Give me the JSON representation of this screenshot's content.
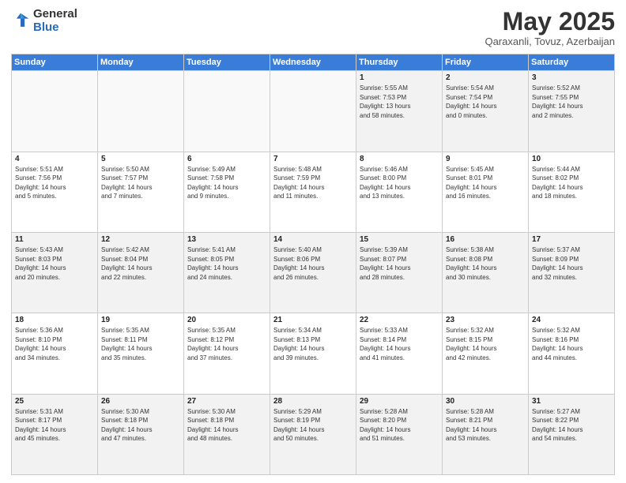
{
  "logo": {
    "general": "General",
    "blue": "Blue"
  },
  "header": {
    "month": "May 2025",
    "location": "Qaraxanli, Tovuz, Azerbaijan"
  },
  "days_of_week": [
    "Sunday",
    "Monday",
    "Tuesday",
    "Wednesday",
    "Thursday",
    "Friday",
    "Saturday"
  ],
  "weeks": [
    [
      {
        "day": "",
        "info": ""
      },
      {
        "day": "",
        "info": ""
      },
      {
        "day": "",
        "info": ""
      },
      {
        "day": "",
        "info": ""
      },
      {
        "day": "1",
        "info": "Sunrise: 5:55 AM\nSunset: 7:53 PM\nDaylight: 13 hours\nand 58 minutes."
      },
      {
        "day": "2",
        "info": "Sunrise: 5:54 AM\nSunset: 7:54 PM\nDaylight: 14 hours\nand 0 minutes."
      },
      {
        "day": "3",
        "info": "Sunrise: 5:52 AM\nSunset: 7:55 PM\nDaylight: 14 hours\nand 2 minutes."
      }
    ],
    [
      {
        "day": "4",
        "info": "Sunrise: 5:51 AM\nSunset: 7:56 PM\nDaylight: 14 hours\nand 5 minutes."
      },
      {
        "day": "5",
        "info": "Sunrise: 5:50 AM\nSunset: 7:57 PM\nDaylight: 14 hours\nand 7 minutes."
      },
      {
        "day": "6",
        "info": "Sunrise: 5:49 AM\nSunset: 7:58 PM\nDaylight: 14 hours\nand 9 minutes."
      },
      {
        "day": "7",
        "info": "Sunrise: 5:48 AM\nSunset: 7:59 PM\nDaylight: 14 hours\nand 11 minutes."
      },
      {
        "day": "8",
        "info": "Sunrise: 5:46 AM\nSunset: 8:00 PM\nDaylight: 14 hours\nand 13 minutes."
      },
      {
        "day": "9",
        "info": "Sunrise: 5:45 AM\nSunset: 8:01 PM\nDaylight: 14 hours\nand 16 minutes."
      },
      {
        "day": "10",
        "info": "Sunrise: 5:44 AM\nSunset: 8:02 PM\nDaylight: 14 hours\nand 18 minutes."
      }
    ],
    [
      {
        "day": "11",
        "info": "Sunrise: 5:43 AM\nSunset: 8:03 PM\nDaylight: 14 hours\nand 20 minutes."
      },
      {
        "day": "12",
        "info": "Sunrise: 5:42 AM\nSunset: 8:04 PM\nDaylight: 14 hours\nand 22 minutes."
      },
      {
        "day": "13",
        "info": "Sunrise: 5:41 AM\nSunset: 8:05 PM\nDaylight: 14 hours\nand 24 minutes."
      },
      {
        "day": "14",
        "info": "Sunrise: 5:40 AM\nSunset: 8:06 PM\nDaylight: 14 hours\nand 26 minutes."
      },
      {
        "day": "15",
        "info": "Sunrise: 5:39 AM\nSunset: 8:07 PM\nDaylight: 14 hours\nand 28 minutes."
      },
      {
        "day": "16",
        "info": "Sunrise: 5:38 AM\nSunset: 8:08 PM\nDaylight: 14 hours\nand 30 minutes."
      },
      {
        "day": "17",
        "info": "Sunrise: 5:37 AM\nSunset: 8:09 PM\nDaylight: 14 hours\nand 32 minutes."
      }
    ],
    [
      {
        "day": "18",
        "info": "Sunrise: 5:36 AM\nSunset: 8:10 PM\nDaylight: 14 hours\nand 34 minutes."
      },
      {
        "day": "19",
        "info": "Sunrise: 5:35 AM\nSunset: 8:11 PM\nDaylight: 14 hours\nand 35 minutes."
      },
      {
        "day": "20",
        "info": "Sunrise: 5:35 AM\nSunset: 8:12 PM\nDaylight: 14 hours\nand 37 minutes."
      },
      {
        "day": "21",
        "info": "Sunrise: 5:34 AM\nSunset: 8:13 PM\nDaylight: 14 hours\nand 39 minutes."
      },
      {
        "day": "22",
        "info": "Sunrise: 5:33 AM\nSunset: 8:14 PM\nDaylight: 14 hours\nand 41 minutes."
      },
      {
        "day": "23",
        "info": "Sunrise: 5:32 AM\nSunset: 8:15 PM\nDaylight: 14 hours\nand 42 minutes."
      },
      {
        "day": "24",
        "info": "Sunrise: 5:32 AM\nSunset: 8:16 PM\nDaylight: 14 hours\nand 44 minutes."
      }
    ],
    [
      {
        "day": "25",
        "info": "Sunrise: 5:31 AM\nSunset: 8:17 PM\nDaylight: 14 hours\nand 45 minutes."
      },
      {
        "day": "26",
        "info": "Sunrise: 5:30 AM\nSunset: 8:18 PM\nDaylight: 14 hours\nand 47 minutes."
      },
      {
        "day": "27",
        "info": "Sunrise: 5:30 AM\nSunset: 8:18 PM\nDaylight: 14 hours\nand 48 minutes."
      },
      {
        "day": "28",
        "info": "Sunrise: 5:29 AM\nSunset: 8:19 PM\nDaylight: 14 hours\nand 50 minutes."
      },
      {
        "day": "29",
        "info": "Sunrise: 5:28 AM\nSunset: 8:20 PM\nDaylight: 14 hours\nand 51 minutes."
      },
      {
        "day": "30",
        "info": "Sunrise: 5:28 AM\nSunset: 8:21 PM\nDaylight: 14 hours\nand 53 minutes."
      },
      {
        "day": "31",
        "info": "Sunrise: 5:27 AM\nSunset: 8:22 PM\nDaylight: 14 hours\nand 54 minutes."
      }
    ]
  ]
}
